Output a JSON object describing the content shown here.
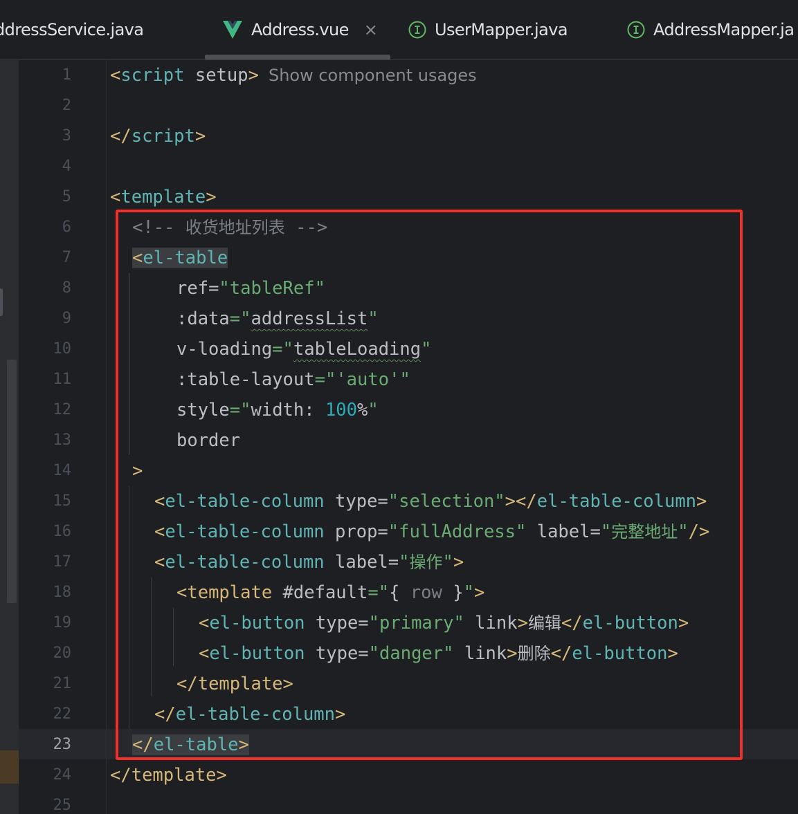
{
  "tabs": [
    {
      "label": "ddressService.java",
      "icon": "none"
    },
    {
      "label": "Address.vue",
      "icon": "vue-icon",
      "active": true,
      "close": "×"
    },
    {
      "label": "UserMapper.java",
      "icon": "interface-icon"
    },
    {
      "label": "AddressMapper.ja",
      "icon": "interface-icon"
    }
  ],
  "editor": {
    "current_line": 23,
    "hint_text": "Show component usages",
    "line_numbers": [
      "1",
      "2",
      "3",
      "4",
      "5",
      "6",
      "7",
      "8",
      "9",
      "10",
      "11",
      "12",
      "13",
      "14",
      "15",
      "16",
      "17",
      "18",
      "19",
      "20",
      "21",
      "22",
      "23",
      "24",
      "25"
    ],
    "code": {
      "l1_open": "<",
      "l1_tag": "script",
      "l1_attr": " setup",
      "l1_close": ">",
      "l3_open": "</",
      "l3_tag": "script",
      "l3_close": ">",
      "l5_open": "<",
      "l5_tag": "template",
      "l5_close": ">",
      "l6_comment": "<!-- ",
      "l6_comment_cjk": "收货地址列表",
      "l6_comment_end": " -->",
      "l7_open": "<",
      "l7_tag": "el-table",
      "l8_attr": "ref",
      "l8_eq": "=",
      "l8_val": "\"tableRef\"",
      "l9_attr": ":data",
      "l9_eq": "=\"",
      "l9_val": "addressList",
      "l9_end": "\"",
      "l10_attr": "v-loading",
      "l10_eq": "=\"",
      "l10_val": "tableLoading",
      "l10_end": "\"",
      "l11_attr": ":table-layout",
      "l11_eq": "=\"",
      "l11_val": "'auto'",
      "l11_end": "\"",
      "l12_attr": "style",
      "l12_eq": "=\"",
      "l12_prop": "width: ",
      "l12_num": "100",
      "l12_pct": "%",
      "l12_end": "\"",
      "l13_attr": "border",
      "l14_close": ">",
      "l15_open": "<",
      "l15_tag": "el-table-column",
      "l15_attr": " type",
      "l15_eq": "=",
      "l15_val": "\"selection\"",
      "l15_mid": "></",
      "l15_tag2": "el-table-column",
      "l15_close": ">",
      "l16_open": "<",
      "l16_tag": "el-table-column",
      "l16_attr": " prop",
      "l16_eq": "=",
      "l16_val": "\"fullAddress\"",
      "l16_attr2": " label",
      "l16_eq2": "=",
      "l16_q1": "\"",
      "l16_cjk": "完整地址",
      "l16_q2": "\"",
      "l16_close": "/>",
      "l17_open": "<",
      "l17_tag": "el-table-column",
      "l17_attr": " label",
      "l17_eq": "=",
      "l17_q1": "\"",
      "l17_cjk": "操作",
      "l17_q2": "\"",
      "l17_close": ">",
      "l18_open": "<",
      "l18_tag": "template",
      "l18_attr": " #default",
      "l18_eq": "=\"",
      "l18_brace1": "{ ",
      "l18_row": "row",
      "l18_brace2": " }",
      "l18_q": "\"",
      "l18_close": ">",
      "l19_open": "<",
      "l19_tag": "el-button",
      "l19_attr": " type",
      "l19_eq": "=",
      "l19_val": "\"primary\"",
      "l19_attr2": " link",
      "l19_gt": ">",
      "l19_cjk": "编辑",
      "l19_endopen": "</",
      "l19_tag2": "el-button",
      "l19_close": ">",
      "l20_open": "<",
      "l20_tag": "el-button",
      "l20_attr": " type",
      "l20_eq": "=",
      "l20_val": "\"danger\"",
      "l20_attr2": " link",
      "l20_gt": ">",
      "l20_cjk": "删除",
      "l20_endopen": "</",
      "l20_tag2": "el-button",
      "l20_close": ">",
      "l21_open": "</",
      "l21_tag": "template",
      "l21_close": ">",
      "l22_open": "</",
      "l22_tag": "el-table-column",
      "l22_close": ">",
      "l23_open": "</",
      "l23_tag": "el-table",
      "l23_close": ">",
      "l24_open": "</",
      "l24_tag": "template",
      "l24_close": ">"
    }
  },
  "colors": {
    "background": "#1e1f22",
    "tag_bracket": "#d5b778",
    "tag_name": "#5fb4b4",
    "string": "#6aab73",
    "number": "#2aacb8",
    "comment": "#7a7e85",
    "annotation_box": "#f0302a",
    "vue_logo": "#41b883",
    "interface_icon": "#5fb865"
  }
}
